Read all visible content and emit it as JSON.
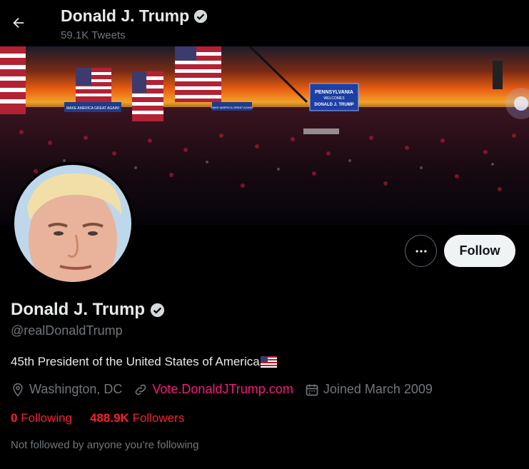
{
  "header": {
    "name": "Donald J. Trump",
    "tweet_count": "59.1K Tweets"
  },
  "banner": {
    "signs": [
      "MAKE AMERICA GREAT AGAIN!",
      "MAKE AMERICA GREAT AGAIN!"
    ],
    "screen_lines": [
      "PENNSYLVANIA",
      "WELCOMES",
      "DONALD J. TRUMP"
    ]
  },
  "actions": {
    "follow_label": "Follow"
  },
  "profile": {
    "display_name": "Donald J. Trump",
    "handle": "@realDonaldTrump",
    "bio": "45th President of the United States of America",
    "location": "Washington, DC",
    "website": "Vote.DonaldJTrump.com",
    "joined": "Joined March 2009"
  },
  "stats": {
    "following_count": "0",
    "following_label": "Following",
    "followers_count": "488.9K",
    "followers_label": "Followers"
  },
  "footnote": "Not followed by anyone you’re following",
  "colors": {
    "background": "#000000",
    "text": "#e7e9ea",
    "muted": "#71767b",
    "link": "#f91880",
    "stat_red": "#f4212e",
    "follow_bg": "#eff3f4"
  }
}
